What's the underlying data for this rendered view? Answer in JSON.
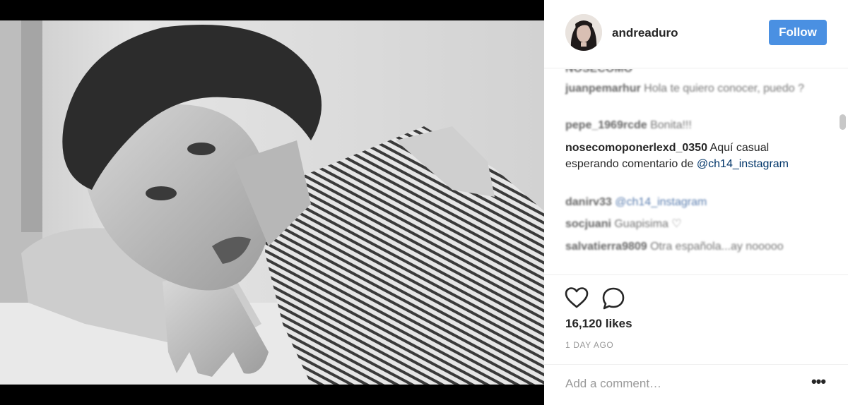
{
  "post": {
    "image_alt": "Black and white portrait photo"
  },
  "header": {
    "username": "andreaduro",
    "follow_label": "Follow"
  },
  "comments": [
    {
      "user": "nosecomoponerlexd_0350",
      "text": "Aquí casual esperando comentario de ",
      "mention": "@ch14_instagram"
    },
    {
      "user": "juanpemarhur",
      "text": "Hola te quiero conocer, puedo ?"
    },
    {
      "user": "pepe_1969rcde",
      "text": "Bonita!!!"
    },
    {
      "user": "danirv33",
      "mention": "@ch14_instagram"
    },
    {
      "user": "socjuani",
      "text": "Guapisima ♡"
    },
    {
      "user": "salvatierra9809",
      "text": "Otra española...ay nooooo"
    }
  ],
  "likes": "16,120 likes",
  "timestamp": "1 DAY AGO",
  "add_comment": {
    "placeholder": "Add a comment…",
    "more_label": "•••"
  },
  "icons": {
    "like": "heart-icon",
    "comment": "comment-icon",
    "more": "more-options-icon"
  },
  "colors": {
    "follow_button": "#4a90e2",
    "mention_link": "#003569",
    "text": "#262626",
    "muted": "#999999"
  }
}
